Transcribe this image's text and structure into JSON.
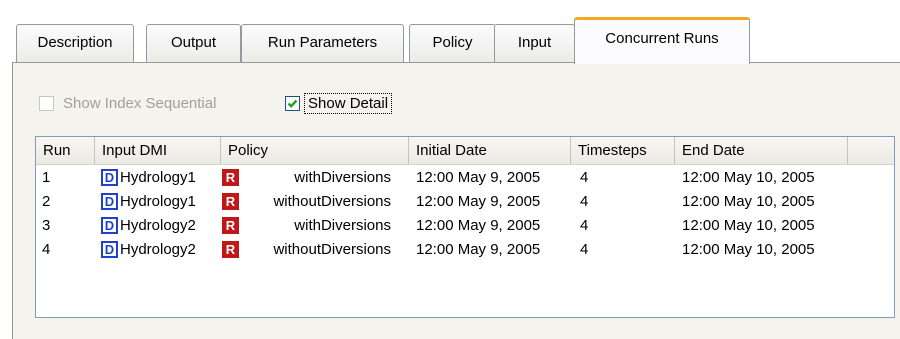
{
  "tabs": [
    {
      "label": "Description"
    },
    {
      "label": "Output"
    },
    {
      "label": "Run Parameters"
    },
    {
      "label": "Policy"
    },
    {
      "label": "Input"
    },
    {
      "label": "Concurrent Runs",
      "active": true
    }
  ],
  "options": {
    "show_index_sequential": {
      "label": "Show Index Sequential",
      "checked": false,
      "enabled": false
    },
    "show_detail": {
      "label": "Show Detail",
      "checked": true,
      "enabled": true
    }
  },
  "list": {
    "columns": [
      "Run",
      "Input DMI",
      "Policy",
      "Initial Date",
      "Timesteps",
      "End Date"
    ],
    "rows": [
      {
        "run": "1",
        "dmi_badge": "D",
        "input_dmi": "Hydrology1",
        "policy_badge": "R",
        "policy": "withDiversions",
        "initial_date": "12:00 May 9, 2005",
        "timesteps": "4",
        "end_date": "12:00 May 10, 2005"
      },
      {
        "run": "2",
        "dmi_badge": "D",
        "input_dmi": "Hydrology1",
        "policy_badge": "R",
        "policy": "withoutDiversions",
        "initial_date": "12:00 May 9, 2005",
        "timesteps": "4",
        "end_date": "12:00 May 10, 2005"
      },
      {
        "run": "3",
        "dmi_badge": "D",
        "input_dmi": "Hydrology2",
        "policy_badge": "R",
        "policy": "withDiversions",
        "initial_date": "12:00 May 9, 2005",
        "timesteps": "4",
        "end_date": "12:00 May 10, 2005"
      },
      {
        "run": "4",
        "dmi_badge": "D",
        "input_dmi": "Hydrology2",
        "policy_badge": "R",
        "policy": "withoutDiversions",
        "initial_date": "12:00 May 9, 2005",
        "timesteps": "4",
        "end_date": "12:00 May 10, 2005"
      }
    ]
  },
  "icons": {
    "dmi_badge_icon": "dmi-icon",
    "policy_badge_icon": "ruleset-icon",
    "check_icon": "checkmark-icon"
  },
  "colors": {
    "active_tab_accent": "#f5a623",
    "dmi_badge": "#2040d0",
    "policy_badge": "#c01818",
    "panel_bg": "#f4f3ee"
  }
}
